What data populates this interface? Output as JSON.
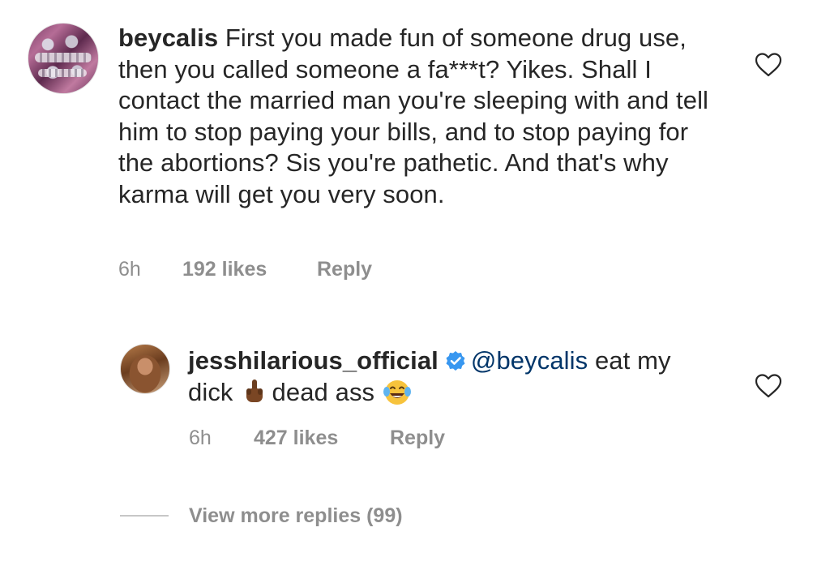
{
  "comments": [
    {
      "username": "beycalis",
      "text": "First you made fun of someone drug use, then you called someone a fa***t? Yikes. Shall I contact the married man you're sleeping with and tell him to stop paying your bills, and to stop paying for the abortions? Sis you're pathetic. And that's why karma will get you very soon.",
      "time": "6h",
      "likes": "192 likes",
      "reply_label": "Reply"
    }
  ],
  "reply": {
    "username": "jesshilarious_official",
    "verified": true,
    "mention": "@beycalis",
    "text_part1": "eat my dick",
    "text_part2": "dead ass",
    "time": "6h",
    "likes": "427 likes",
    "reply_label": "Reply"
  },
  "view_more_label": "View more replies (99)",
  "icons": {
    "like": "heart-outline-icon",
    "verified": "verified-badge-icon",
    "emoji1": "middle-finger-emoji",
    "emoji2": "tears-of-joy-emoji"
  },
  "colors": {
    "text": "#262626",
    "meta": "#8e8e8e",
    "mention": "#003569",
    "verified": "#3897f0"
  }
}
